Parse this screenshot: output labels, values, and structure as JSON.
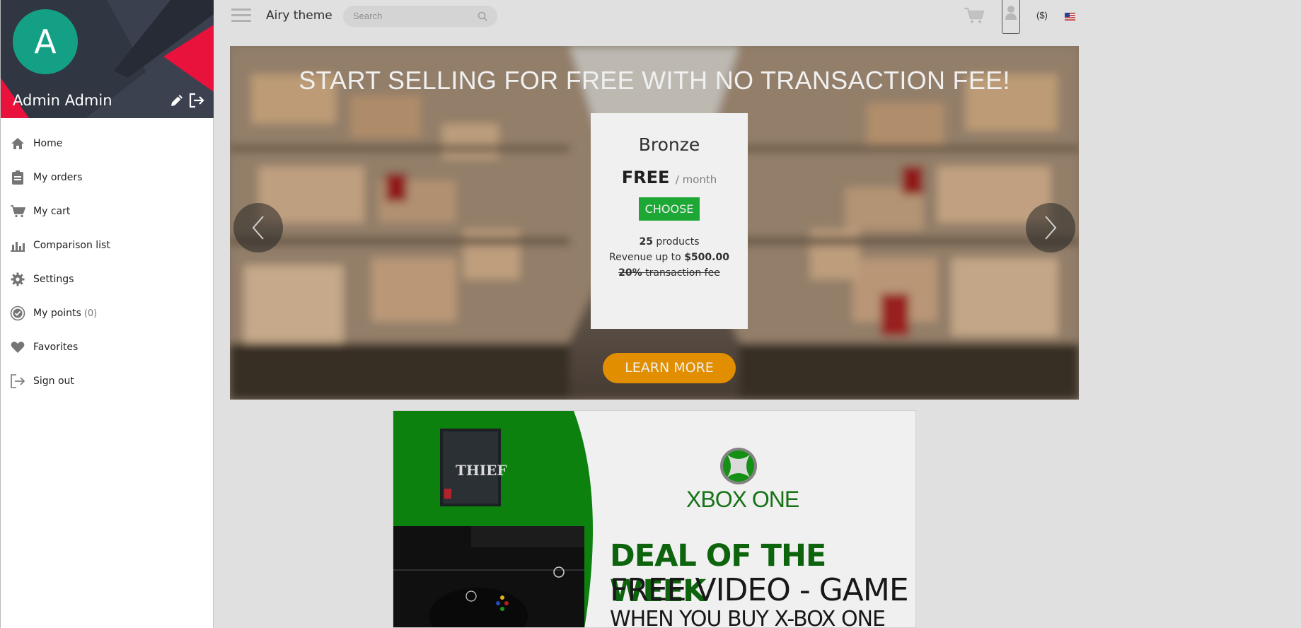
{
  "header": {
    "brand": "Airy theme",
    "search_placeholder": "Search",
    "currency": "($)",
    "icons": [
      "menu-icon",
      "search-icon",
      "cart-icon",
      "user-icon",
      "us-flag-icon"
    ]
  },
  "banner": {
    "title": "START SELLING FOR FREE WITH NO TRANSACTION FEE!",
    "plan": {
      "name": "Bronze",
      "price": "FREE",
      "period": "/ month",
      "choose_label": "CHOOSE",
      "products_count": "25",
      "products_label": "products",
      "revenue_prefix": "Revenue up to",
      "revenue_value": "$500.00",
      "fee_value": "20%",
      "fee_label": "transaction fee"
    },
    "learn_more_label": "LEARN MORE",
    "colors": {
      "choose": "#1fb33a",
      "learn_more": "#f09700"
    }
  },
  "promo": {
    "game_title": "THIEF",
    "brand": "XBOX ONE",
    "line1": "DEAL OF THE WEEK",
    "line2": "FREE VIDEO - GAME",
    "line3": "WHEN YOU BUY X-BOX ONE",
    "colors": {
      "green": "#0e8a0e"
    }
  },
  "drawer": {
    "avatar_letter": "A",
    "user_name": "Admin Admin",
    "accent": "#14a085",
    "menu": [
      {
        "label": "Home",
        "icon": "home-icon"
      },
      {
        "label": "My orders",
        "icon": "clipboard-icon"
      },
      {
        "label": "My cart",
        "icon": "cart-icon"
      },
      {
        "label": "Comparison list",
        "icon": "bar-chart-icon"
      },
      {
        "label": "Settings",
        "icon": "gear-icon"
      },
      {
        "label": "My points",
        "count": "(0)",
        "icon": "points-icon"
      },
      {
        "label": "Favorites",
        "icon": "heart-icon"
      },
      {
        "label": "Sign out",
        "icon": "sign-out-icon"
      }
    ]
  }
}
